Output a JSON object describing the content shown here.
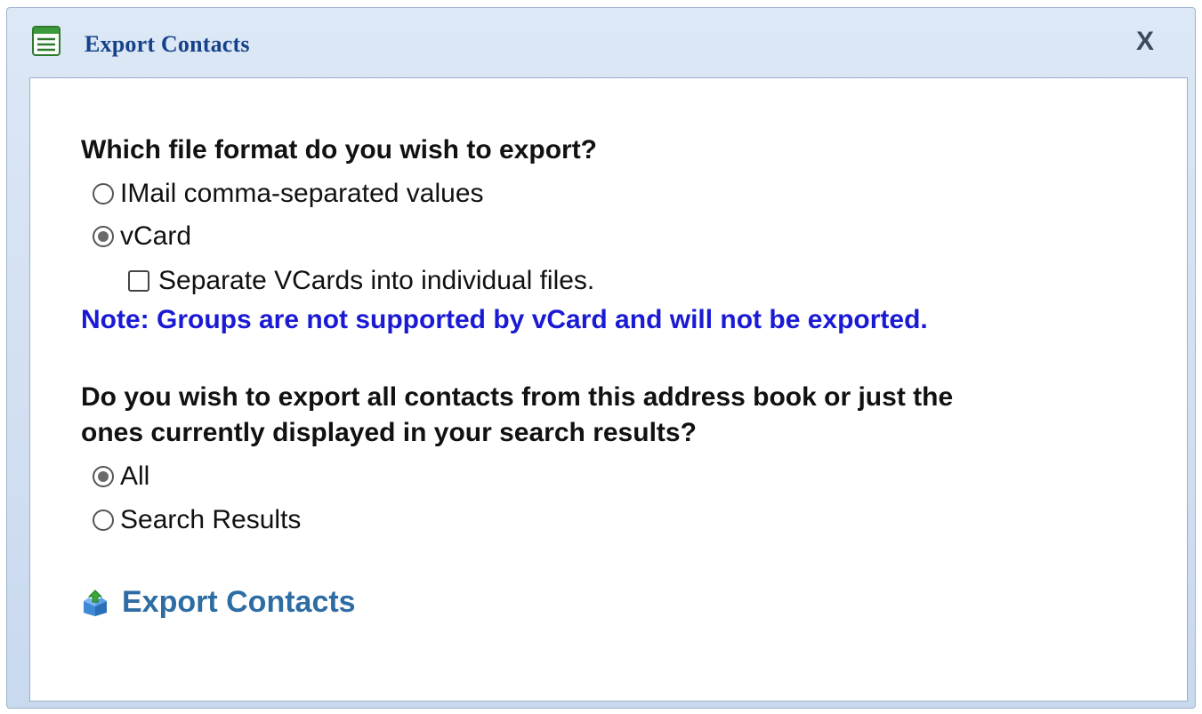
{
  "dialog": {
    "title": "Export Contacts",
    "close_label": "X"
  },
  "format_section": {
    "question": "Which file format do you wish to export?",
    "options": [
      {
        "label": "IMail comma-separated values",
        "selected": false
      },
      {
        "label": "vCard",
        "selected": true
      }
    ],
    "separate_checkbox": {
      "label": "Separate VCards into individual files.",
      "checked": false
    },
    "note": "Note: Groups are not supported by vCard and will not be exported."
  },
  "scope_section": {
    "question_line1": "Do you wish to export all contacts from this address book or just the",
    "question_line2": "ones currently displayed in your search results?",
    "options": [
      {
        "label": "All",
        "selected": true
      },
      {
        "label": "Search Results",
        "selected": false
      }
    ]
  },
  "export_action": {
    "label": "Export Contacts"
  },
  "colors": {
    "title": "#15428b",
    "note": "#1a1ad4",
    "link": "#2e6da4"
  }
}
